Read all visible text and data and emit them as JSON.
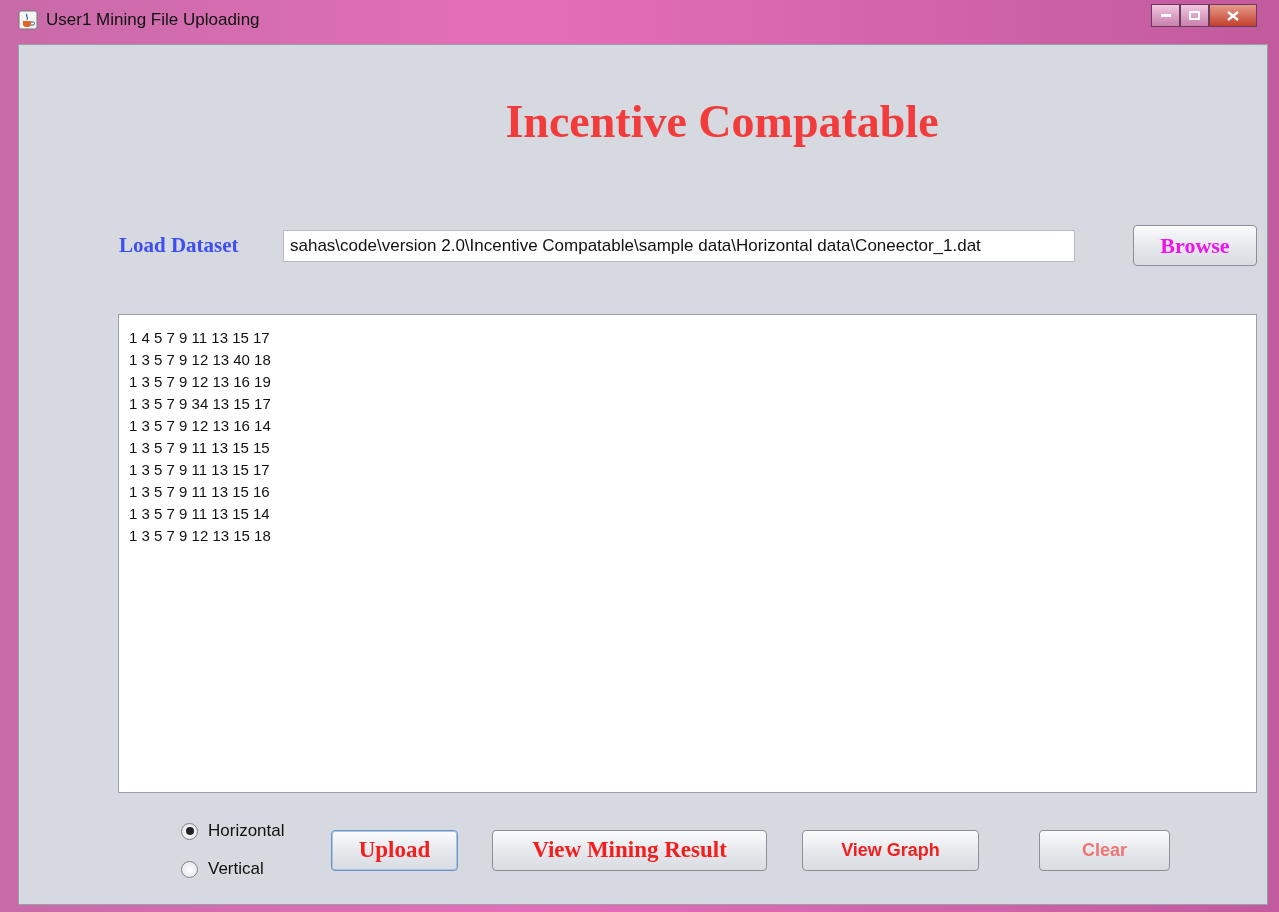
{
  "window": {
    "title": "User1 Mining File Uploading"
  },
  "heading": "Incentive Compatable",
  "dataset": {
    "label": "Load Dataset",
    "value": "sahas\\code\\version 2.0\\Incentive Compatable\\sample data\\Horizontal data\\Coneector_1.dat",
    "browse": "Browse"
  },
  "data_lines": [
    "1 4 5 7 9 11 13 15 17",
    "1 3 5 7 9 12 13 40 18",
    "1 3 5 7 9 12 13 16 19",
    "1 3 5 7 9 34 13 15 17",
    "1 3 5 7 9 12 13 16 14",
    "1 3 5 7 9 11 13 15 15",
    "1 3 5 7 9 11 13 15 17",
    "1 3 5 7 9 11 13 15 16",
    "1 3 5 7 9 11 13 15 14",
    "1 3 5 7 9 12 13 15 18"
  ],
  "layout_options": [
    {
      "label": "Horizontal",
      "selected": true
    },
    {
      "label": "Vertical",
      "selected": false
    }
  ],
  "buttons": [
    {
      "label": "Upload",
      "kind": "serif",
      "focused": true,
      "disabled": false
    },
    {
      "label": "View Mining Result",
      "kind": "serif",
      "focused": false,
      "disabled": false
    },
    {
      "label": "View Graph",
      "kind": "sans",
      "focused": false,
      "disabled": false
    },
    {
      "label": "Clear",
      "kind": "sans",
      "focused": false,
      "disabled": true
    }
  ]
}
